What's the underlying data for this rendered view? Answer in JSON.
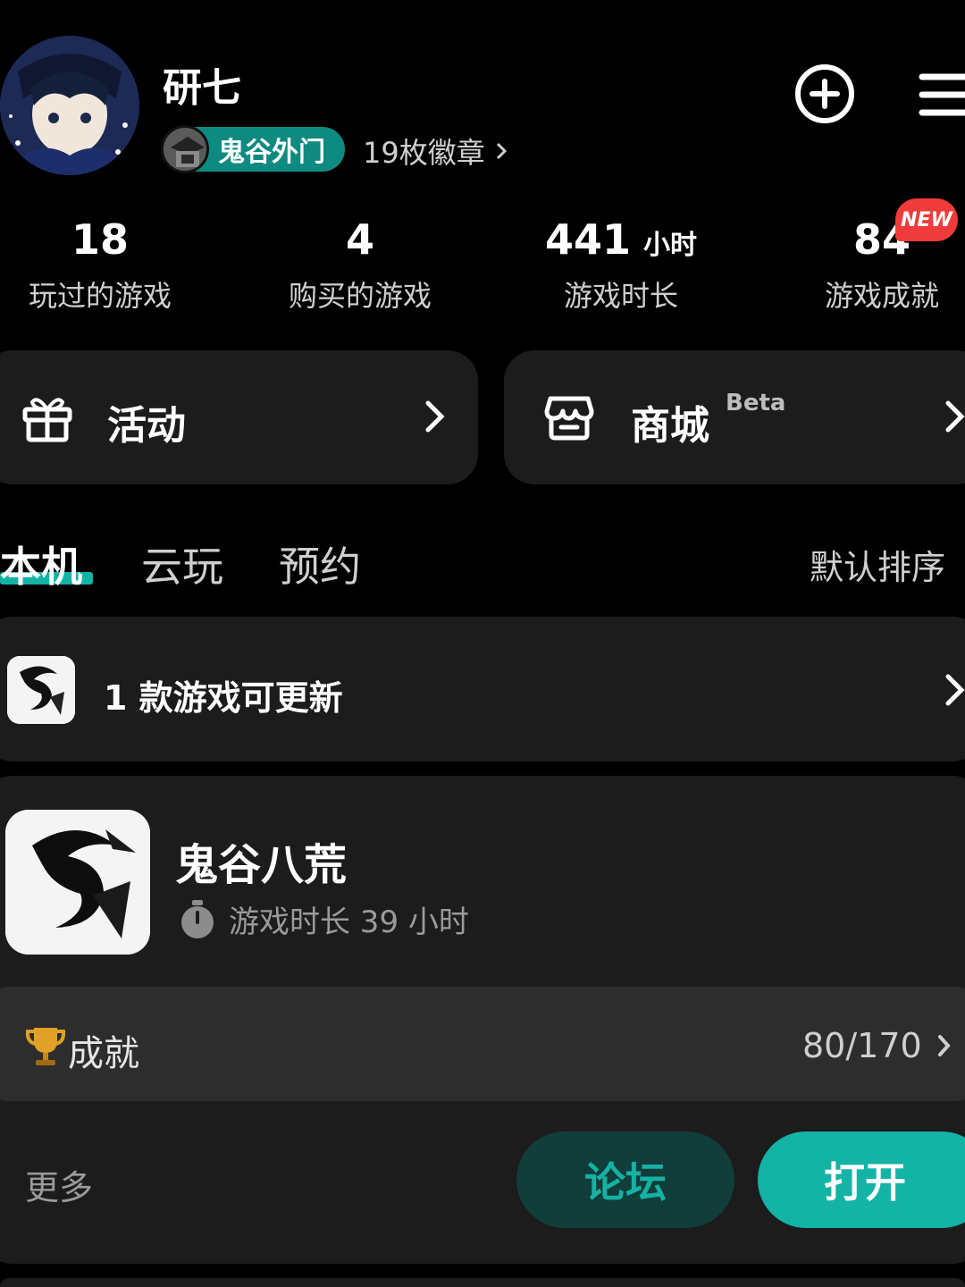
{
  "profile": {
    "username": "研七",
    "badge_label": "鬼谷外门",
    "badges_count": "19枚徽章"
  },
  "header_icons": {
    "add": "plus-circle-icon",
    "menu": "hamburger-menu-icon"
  },
  "stats": [
    {
      "value": "18",
      "unit": "",
      "label": "玩过的游戏"
    },
    {
      "value": "4",
      "unit": "",
      "label": "购买的游戏"
    },
    {
      "value": "441",
      "unit": "小时",
      "label": "游戏时长"
    },
    {
      "value": "84",
      "unit": "",
      "label": "游戏成就",
      "tag": "NEW"
    }
  ],
  "cards": {
    "activity_label": "活动",
    "shop_label": "商城",
    "shop_tag": "Beta"
  },
  "tabs": [
    "本机",
    "云玩",
    "预约"
  ],
  "active_tab": "本机",
  "sort_label": "默认排序",
  "update_banner": "1 款游戏可更新",
  "game": {
    "title": "鬼谷八荒",
    "playtime": "游戏时长 39 小时",
    "achievement_label": "成就",
    "achievement_value": "80/170",
    "more_label": "更多",
    "forum_button": "论坛",
    "open_button": "打开"
  },
  "colors": {
    "accent": "#13b3a5",
    "accent_dark": "#113e3a",
    "card_bg": "#1c1c1c",
    "new_tag": "#ef3b3b"
  }
}
